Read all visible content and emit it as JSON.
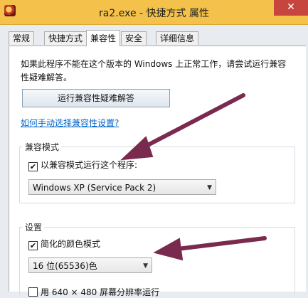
{
  "window": {
    "title": "ra2.exe - 快捷方式 属性",
    "close_glyph": "✕"
  },
  "tabs": [
    {
      "label": "常规",
      "active": false
    },
    {
      "label": "快捷方式",
      "active": false
    },
    {
      "label": "兼容性",
      "active": true
    },
    {
      "label": "安全",
      "active": false
    },
    {
      "label": "详细信息",
      "active": false
    }
  ],
  "compat_page": {
    "intro": "如果此程序不能在这个版本的 Windows 上正常工作，请尝试运行兼容性疑难解答。",
    "troubleshoot_button": "运行兼容性疑难解答",
    "manual_link": "如何手动选择兼容性设置?",
    "compat_mode": {
      "group_title": "兼容模式",
      "checkbox_label": "以兼容模式运行这个程序:",
      "checked": true,
      "selected_os": "Windows XP (Service Pack 2)"
    },
    "settings": {
      "group_title": "设置",
      "reduced_color_label": "简化的颜色模式",
      "reduced_color_checked": true,
      "color_depth": "16 位(65536)色",
      "low_res_label": "用 640 × 480 屏幕分辨率运行",
      "low_res_checked": false
    }
  },
  "colors": {
    "titlebar": "#f4c24a",
    "close_button": "#c7453f",
    "annotation_arrow": "#7a2a4e",
    "link": "#0066cc"
  },
  "icons": {
    "app": "red-alert-app-icon",
    "dropdown": "chevron-down-icon"
  }
}
